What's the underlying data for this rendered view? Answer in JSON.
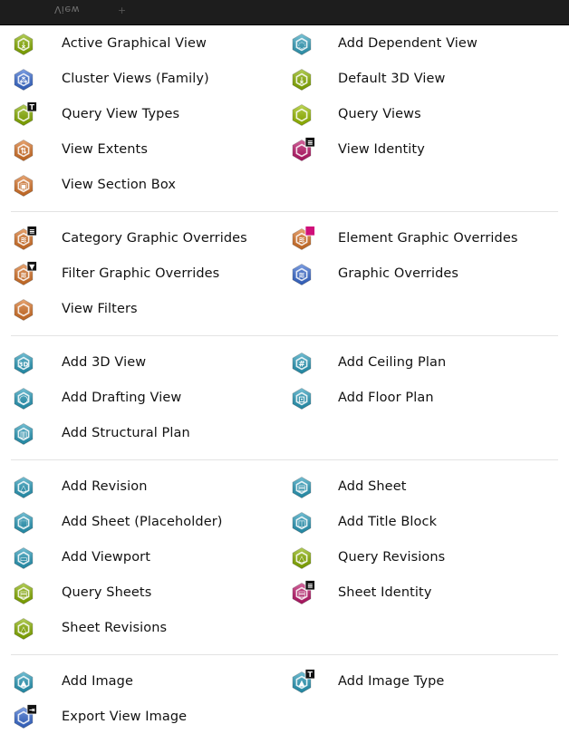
{
  "header": {
    "tab_label": "View",
    "add_tab": "+"
  },
  "groups": [
    {
      "name": "view",
      "items": [
        {
          "label": "Active Graphical View",
          "icon": "active-graphical-view-icon",
          "color": "#8db600",
          "glyph": "⤓",
          "badge": ""
        },
        {
          "label": "Add Dependent View",
          "icon": "add-dependent-view-icon",
          "color": "#36a7c4",
          "glyph": "◌",
          "badge": ""
        },
        {
          "label": "Cluster Views (Family)",
          "icon": "cluster-views-icon",
          "color": "#3b6fd8",
          "glyph": "⁂",
          "badge": ""
        },
        {
          "label": "Default 3D View",
          "icon": "default-3d-view-icon",
          "color": "#8db600",
          "glyph": "⤓",
          "badge": ""
        },
        {
          "label": "Query View Types",
          "icon": "query-view-types-icon",
          "color": "#8db600",
          "glyph": "",
          "badge": "T"
        },
        {
          "label": "Query Views",
          "icon": "query-views-icon",
          "color": "#9fc400",
          "glyph": "",
          "badge": ""
        },
        {
          "label": "View Extents",
          "icon": "view-extents-icon",
          "color": "#e0782a",
          "glyph": "⇅",
          "badge": ""
        },
        {
          "label": "View Identity",
          "icon": "view-identity-icon",
          "color": "#c3186e",
          "glyph": "",
          "badge": "≡"
        },
        {
          "label": "View Section Box",
          "icon": "view-section-box-icon",
          "color": "#e0782a",
          "glyph": "▣",
          "badge": ""
        }
      ]
    },
    {
      "name": "graphic-overrides",
      "items": [
        {
          "label": "Category Graphic Overrides",
          "icon": "category-graphic-overrides-icon",
          "color": "#e0782a",
          "glyph": "≋",
          "badge": "≡"
        },
        {
          "label": "Element Graphic Overrides",
          "icon": "element-graphic-overrides-icon",
          "color": "#e0782a",
          "glyph": "≋",
          "badge": "◆"
        },
        {
          "label": "Filter Graphic Overrides",
          "icon": "filter-graphic-overrides-icon",
          "color": "#e0782a",
          "glyph": "≋",
          "badge": "▼"
        },
        {
          "label": "Graphic Overrides",
          "icon": "graphic-overrides-icon",
          "color": "#3b6fd8",
          "glyph": "≋",
          "badge": ""
        },
        {
          "label": "View Filters",
          "icon": "view-filters-icon",
          "color": "#e0782a",
          "glyph": "",
          "badge": ""
        }
      ]
    },
    {
      "name": "plans",
      "items": [
        {
          "label": "Add 3D View",
          "icon": "add-3d-view-icon",
          "color": "#2aa0c0",
          "glyph": "3D",
          "badge": ""
        },
        {
          "label": "Add Ceiling Plan",
          "icon": "add-ceiling-plan-icon",
          "color": "#2aa0c0",
          "glyph": "#",
          "badge": ""
        },
        {
          "label": "Add Drafting View",
          "icon": "add-drafting-view-icon",
          "color": "#2aa0c0",
          "glyph": "◯",
          "badge": ""
        },
        {
          "label": "Add Floor Plan",
          "icon": "add-floor-plan-icon",
          "color": "#2aa0c0",
          "glyph": "⊡",
          "badge": ""
        },
        {
          "label": "Add Structural Plan",
          "icon": "add-structural-plan-icon",
          "color": "#2aa0c0",
          "glyph": "▥",
          "badge": ""
        }
      ]
    },
    {
      "name": "sheets",
      "items": [
        {
          "label": "Add Revision",
          "icon": "add-revision-icon",
          "color": "#2aa0c0",
          "glyph": "△",
          "badge": ""
        },
        {
          "label": "Add Sheet",
          "icon": "add-sheet-icon",
          "color": "#2aa0c0",
          "glyph": "▤",
          "badge": ""
        },
        {
          "label": "Add Sheet (Placeholder)",
          "icon": "add-sheet-placeholder-icon",
          "color": "#2aa0c0",
          "glyph": "⬚",
          "badge": ""
        },
        {
          "label": "Add Title Block",
          "icon": "add-title-block-icon",
          "color": "#2aa0c0",
          "glyph": "◫",
          "badge": ""
        },
        {
          "label": "Add Viewport",
          "icon": "add-viewport-icon",
          "color": "#2aa0c0",
          "glyph": "▭",
          "badge": ""
        },
        {
          "label": "Query Revisions",
          "icon": "query-revisions-icon",
          "color": "#8db600",
          "glyph": "△",
          "badge": ""
        },
        {
          "label": "Query Sheets",
          "icon": "query-sheets-icon",
          "color": "#8db600",
          "glyph": "▤",
          "badge": ""
        },
        {
          "label": "Sheet Identity",
          "icon": "sheet-identity-icon",
          "color": "#c3186e",
          "glyph": "▤",
          "badge": "≡"
        },
        {
          "label": "Sheet Revisions",
          "icon": "sheet-revisions-icon",
          "color": "#8db600",
          "glyph": "△",
          "badge": ""
        }
      ]
    },
    {
      "name": "image",
      "items": [
        {
          "label": "Add Image",
          "icon": "add-image-icon",
          "color": "#2aa0c0",
          "glyph": "▲",
          "badge": ""
        },
        {
          "label": "Add Image Type",
          "icon": "add-image-type-icon",
          "color": "#2aa0c0",
          "glyph": "▲",
          "badge": "T"
        },
        {
          "label": "Export View Image",
          "icon": "export-view-image-icon",
          "color": "#3b6fd8",
          "glyph": "",
          "badge": "⇥"
        }
      ]
    }
  ]
}
